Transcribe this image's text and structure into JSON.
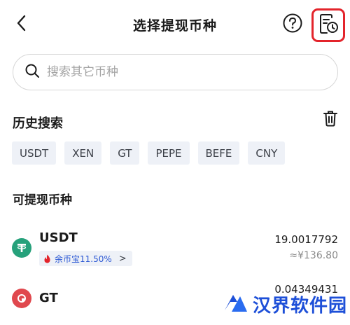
{
  "header": {
    "title": "选择提现币种",
    "back_icon": "chevron-left-icon",
    "help_icon": "question-circle-icon",
    "history_icon": "document-clock-icon",
    "highlight_color": "#e3242b"
  },
  "search": {
    "placeholder": "搜索其它币种",
    "value": ""
  },
  "history": {
    "title": "历史搜索",
    "clear_icon": "trash-icon",
    "chips": [
      "USDT",
      "XEN",
      "GT",
      "PEPE",
      "BEFE",
      "CNY"
    ]
  },
  "available": {
    "title": "可提现币种",
    "coins": [
      {
        "name": "USDT",
        "icon": "tether-icon",
        "icon_color": "#26a17b",
        "badge_label": "余币宝11.50%",
        "badge_chevron": ">",
        "amount": "19.0017792",
        "fiat": "≈¥136.80"
      },
      {
        "name": "GT",
        "icon": "gatetoken-icon",
        "icon_color": "#e0484e",
        "amount": "0.04349431"
      }
    ]
  },
  "watermark": {
    "text": "汉界软件园",
    "color": "#1d4fd8"
  }
}
